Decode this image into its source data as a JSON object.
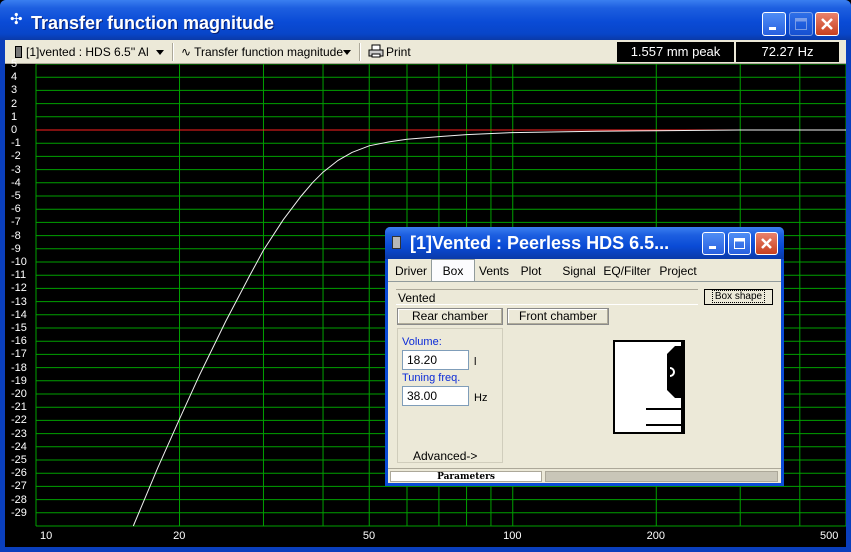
{
  "window": {
    "title": "Transfer function magnitude"
  },
  "toolbar": {
    "project_select": "[1]vented : HDS 6.5'' Al",
    "plot_select": "Transfer function magnitude",
    "print_label": "Print",
    "readout_excursion": "1.557 mm peak",
    "readout_frequency": "72.27 Hz"
  },
  "plot": {
    "y_ticks": [
      "5",
      "4",
      "3",
      "2",
      "1",
      "0",
      "-1",
      "-2",
      "-3",
      "-4",
      "-5",
      "-6",
      "-7",
      "-8",
      "-9",
      "-10",
      "-11",
      "-12",
      "-13",
      "-14",
      "-15",
      "-16",
      "-17",
      "-18",
      "-19",
      "-20",
      "-21",
      "-22",
      "-23",
      "-24",
      "-25",
      "-26",
      "-27",
      "-28",
      "-29"
    ],
    "x_ticks": [
      {
        "label": "10",
        "value": 10
      },
      {
        "label": "20",
        "value": 20
      },
      {
        "label": "50",
        "value": 50
      },
      {
        "label": "100",
        "value": 100
      },
      {
        "label": "200",
        "value": 200
      },
      {
        "label": "500",
        "value": 500
      }
    ],
    "colors": {
      "grid": "#00a000",
      "curve": "#f0f0f0",
      "reference": "#ff2020"
    }
  },
  "chart_data": {
    "type": "line",
    "title": "",
    "xlabel": "",
    "ylabel": "",
    "x_scale": "log",
    "xlim": [
      10,
      500
    ],
    "ylim": [
      -30,
      5
    ],
    "grid": true,
    "series": [
      {
        "x": [
          16,
          18,
          20,
          22,
          25,
          28,
          30,
          33,
          36,
          38,
          40,
          43,
          46,
          50,
          55,
          60,
          70,
          80,
          100,
          150,
          200,
          300,
          400,
          500
        ],
        "y": [
          -30,
          -25.6,
          -21.9,
          -18.6,
          -14.5,
          -11.1,
          -9.1,
          -6.8,
          -5.0,
          -4.0,
          -3.2,
          -2.3,
          -1.7,
          -1.2,
          -0.9,
          -0.7,
          -0.5,
          -0.35,
          -0.2,
          -0.1,
          -0.05,
          0,
          0,
          0
        ]
      }
    ],
    "reference_line": {
      "y": 0
    }
  },
  "child_window": {
    "title": "[1]Vented : Peerless HDS 6.5...",
    "tabs": [
      "Driver",
      "Box",
      "Vents",
      "Plot",
      "Signal",
      "EQ/Filter",
      "Project"
    ],
    "active_tab": "Box",
    "box_type": "Vented",
    "box_shape_label": "Box shape",
    "rear_chamber_label": "Rear chamber",
    "front_chamber_label": "Front chamber",
    "volume_label": "Volume:",
    "volume_value": "18.20",
    "volume_unit": "l",
    "tuning_label": "Tuning freq.",
    "tuning_value": "38.00",
    "tuning_unit": "Hz",
    "advanced_label": "Advanced->",
    "status_label": "Parameters"
  }
}
